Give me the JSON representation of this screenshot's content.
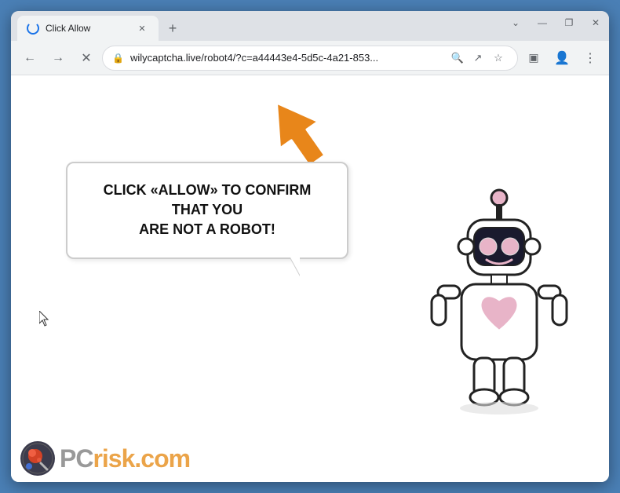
{
  "browser": {
    "tab": {
      "title": "Click Allow",
      "spinner": true
    },
    "new_tab_label": "+",
    "window_controls": {
      "chevron_down": "⌄",
      "minimize": "—",
      "maximize": "❐",
      "close": "✕"
    },
    "nav": {
      "back_label": "←",
      "forward_label": "→",
      "reload_label": "✕",
      "address": "wilycaptcha.live/robot4/?c=a44443e4-5d5c-4a21-853...",
      "lock_symbol": "🔒"
    },
    "toolbar_icons": [
      "search",
      "share",
      "star",
      "sidebar",
      "profile",
      "menu"
    ]
  },
  "page": {
    "bubble_text_line1": "CLICK «ALLOW» TO CONFIRM THAT YOU",
    "bubble_text_line2": "ARE NOT A ROBOT!",
    "watermark_text": "PC",
    "watermark_suffix": "risk.com"
  },
  "colors": {
    "browser_frame": "#4a7fb5",
    "tab_bg": "#f1f3f4",
    "nav_bg": "#f1f3f4",
    "accent": "#1a73e8",
    "arrow_color": "#e8861a"
  }
}
